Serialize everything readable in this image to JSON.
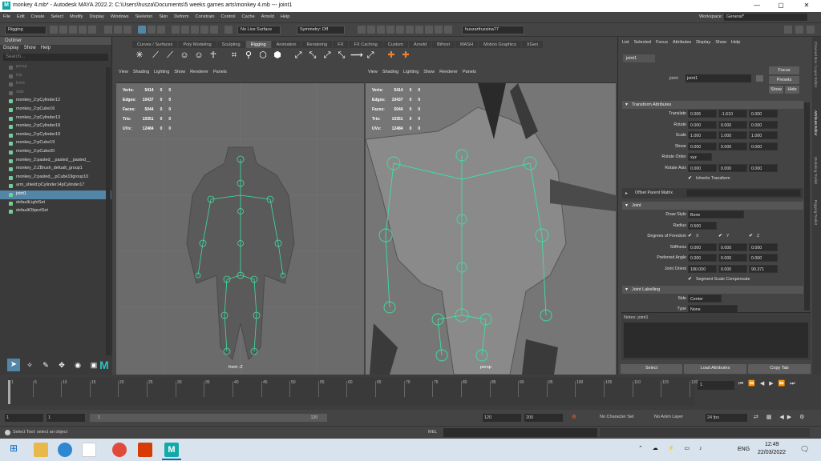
{
  "window": {
    "title": "monkey 4.mb* - Autodesk MAYA 2022.2: C:\\Users\\husza\\Documents\\5 weeks games arts\\monkey 4.mb  ---  joint1",
    "app_icon": "M",
    "controls": [
      "—",
      "▢",
      "✕"
    ]
  },
  "menubar": {
    "items": [
      "File",
      "Edit",
      "Create",
      "Select",
      "Modify",
      "Display",
      "Windows",
      "Skeleton",
      "Skin",
      "Deform",
      "Constrain",
      "Control",
      "Cache",
      "Arnold",
      "Help"
    ],
    "workspace_label": "Workspace:",
    "workspace_value": "General*"
  },
  "toolbar": {
    "mode": "Rigging",
    "live_surface": "No Live Surface",
    "symmetry": "Symmetry: Off",
    "user": "huszarfruzsina77"
  },
  "outliner": {
    "title": "Outliner",
    "menu": [
      "Display",
      "Show",
      "Help"
    ],
    "search_placeholder": "Search...",
    "items": [
      {
        "label": "persp",
        "dim": true
      },
      {
        "label": "top",
        "dim": true
      },
      {
        "label": "front",
        "dim": true
      },
      {
        "label": "side",
        "dim": true
      },
      {
        "label": "monkey_2:pCylinder12"
      },
      {
        "label": "monkey_2:pCube16"
      },
      {
        "label": "monkey_2:pCylinder13"
      },
      {
        "label": "monkey_2:pCylinder18"
      },
      {
        "label": "monkey_2:pCylinder19"
      },
      {
        "label": "monkey_2:pCube19"
      },
      {
        "label": "monkey_2:pCube20"
      },
      {
        "label": "monkey_2:pasted__pasted__pasted__"
      },
      {
        "label": "monkey_2:ZBrush_defualt_group1"
      },
      {
        "label": "monkey_2:pasted__pCube19group10"
      },
      {
        "label": "arm_shield:pCylinder14pCylinder17"
      },
      {
        "label": "joint1",
        "selected": true
      },
      {
        "label": "defaultLightSet"
      },
      {
        "label": "defaultObjectSet"
      }
    ]
  },
  "shelf": {
    "tabs": [
      "Curves / Surfaces",
      "Poly Modeling",
      "Sculpting",
      "Rigging",
      "Animation",
      "Rendering",
      "FX",
      "FX Caching",
      "Custom",
      "Arnold",
      "Bifrost",
      "MASH",
      "Motion Graphics",
      "XGen"
    ],
    "active": "Rigging"
  },
  "viewport": {
    "menu": [
      "View",
      "Shading",
      "Lighting",
      "Show",
      "Renderer",
      "Panels"
    ],
    "hud_left": [
      [
        "Verts:",
        "5414",
        "0",
        "0"
      ],
      [
        "Edges:",
        "10437",
        "0",
        "0"
      ],
      [
        "Faces:",
        "5044",
        "0",
        "0"
      ],
      [
        "Tris:",
        "10351",
        "0",
        "0"
      ],
      [
        "UVs:",
        "12484",
        "0",
        "0"
      ]
    ],
    "hud_right": [
      [
        "Verts:",
        "5414",
        "0",
        "0"
      ],
      [
        "Edges:",
        "10437",
        "0",
        "0"
      ],
      [
        "Faces:",
        "5044",
        "0",
        "0"
      ],
      [
        "Tris:",
        "10351",
        "0",
        "0"
      ],
      [
        "UVs:",
        "12484",
        "0",
        "0"
      ]
    ],
    "left_label": "front -Z",
    "right_label": "persp"
  },
  "attr": {
    "menu": [
      "List",
      "Selected",
      "Focus",
      "Attributes",
      "Display",
      "Show",
      "Help"
    ],
    "tab": "joint1",
    "node_label": "joint:",
    "node_value": "joint1",
    "focus": "Focus",
    "presets": "Presets",
    "show": "Show",
    "hide": "Hide",
    "transform_title": "Transform Attributes",
    "translate": [
      "0.006",
      "-1.610",
      "0.000"
    ],
    "rotate": [
      "0.000",
      "0.000",
      "0.000"
    ],
    "scale": [
      "1.000",
      "1.000",
      "1.000"
    ],
    "shear": [
      "0.000",
      "0.000",
      "0.000"
    ],
    "rotate_order": "xyz",
    "rotate_axis": [
      "0.000",
      "0.000",
      "0.000"
    ],
    "inherits": "Inherits Transform",
    "labels": {
      "translate": "Translate",
      "rotate": "Rotate",
      "scale": "Scale",
      "shear": "Shear",
      "rotate_order": "Rotate Order",
      "rotate_axis": "Rotate Axis",
      "draw_style": "Draw Style",
      "radius": "Radius",
      "dof": "Degrees of Freedom",
      "stiffness": "Stiffness",
      "pref": "Preferred Angle",
      "orient": "Joint Orient",
      "side": "Side",
      "type": "Type"
    },
    "offset_parent": "Offset Parent Matrix",
    "joint_title": "Joint",
    "draw_style": "Bone",
    "radius": "0.500",
    "dof": [
      "X",
      "Y",
      "Z"
    ],
    "stiffness": [
      "0.000",
      "0.000",
      "0.000"
    ],
    "preferred": [
      "0.000",
      "0.000",
      "0.000"
    ],
    "orient": [
      "180.000",
      "0.000",
      "90.371"
    ],
    "ssc": "Segment Scale Compensate",
    "labelling_title": "Joint Labelling",
    "side": "Center",
    "type": "None",
    "notes": "Notes: joint1",
    "select": "Select",
    "load": "Load Attributes",
    "copy": "Copy Tab"
  },
  "sidetabs": [
    "Channel Box / Layer Editor",
    "Attribute Editor",
    "Modeling Toolkit",
    "Rigging Toolkit"
  ],
  "timeline": {
    "ticks": [
      "1",
      "5",
      "10",
      "15",
      "20",
      "25",
      "30",
      "35",
      "40",
      "45",
      "50",
      "55",
      "60",
      "65",
      "70",
      "75",
      "80",
      "85",
      "90",
      "95",
      "100",
      "105",
      "110",
      "115",
      "120"
    ],
    "current": "1"
  },
  "range": {
    "start": "1",
    "start2": "1",
    "slider_start": "1",
    "slider_end": "120",
    "end": "120",
    "end2": "200",
    "char_set": "No Character Set",
    "anim_layer": "No Anim Layer",
    "fps": "24 fps"
  },
  "cmd": {
    "help": "Select Tool: select an object",
    "lang": "MEL"
  },
  "taskbar": {
    "time": "12:49",
    "date": "22/03/2022",
    "lang": "ENG"
  }
}
